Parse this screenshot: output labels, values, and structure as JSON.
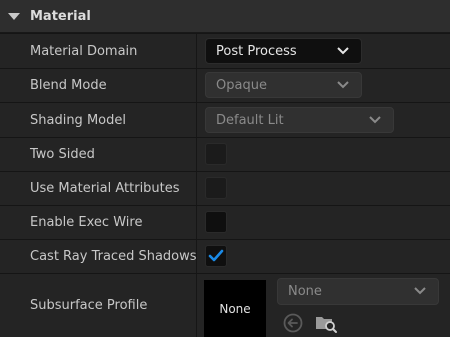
{
  "section": {
    "title": "Material"
  },
  "rows": {
    "material_domain": {
      "label": "Material Domain",
      "value": "Post Process"
    },
    "blend_mode": {
      "label": "Blend Mode",
      "value": "Opaque"
    },
    "shading_model": {
      "label": "Shading Model",
      "value": "Default Lit"
    },
    "two_sided": {
      "label": "Two Sided",
      "checked": false
    },
    "use_material_attributes": {
      "label": "Use Material Attributes",
      "checked": false
    },
    "enable_exec_wire": {
      "label": "Enable Exec Wire",
      "checked": false
    },
    "cast_ray_traced_shadows": {
      "label": "Cast Ray Traced Shadows",
      "checked": true
    },
    "subsurface_profile": {
      "label": "Subsurface Profile",
      "thumbnail_text": "None",
      "value": "None"
    }
  },
  "icons": {
    "collapse": "triangle-down-icon",
    "dropdown": "chevron-down-icon",
    "check": "checkmark-icon",
    "use_selected": "arrow-left-circle-icon",
    "browse": "folder-search-icon"
  },
  "colors": {
    "accent_check": "#1b8ae6",
    "panel_bg": "#242424",
    "header_bg": "#2e2e2e"
  }
}
